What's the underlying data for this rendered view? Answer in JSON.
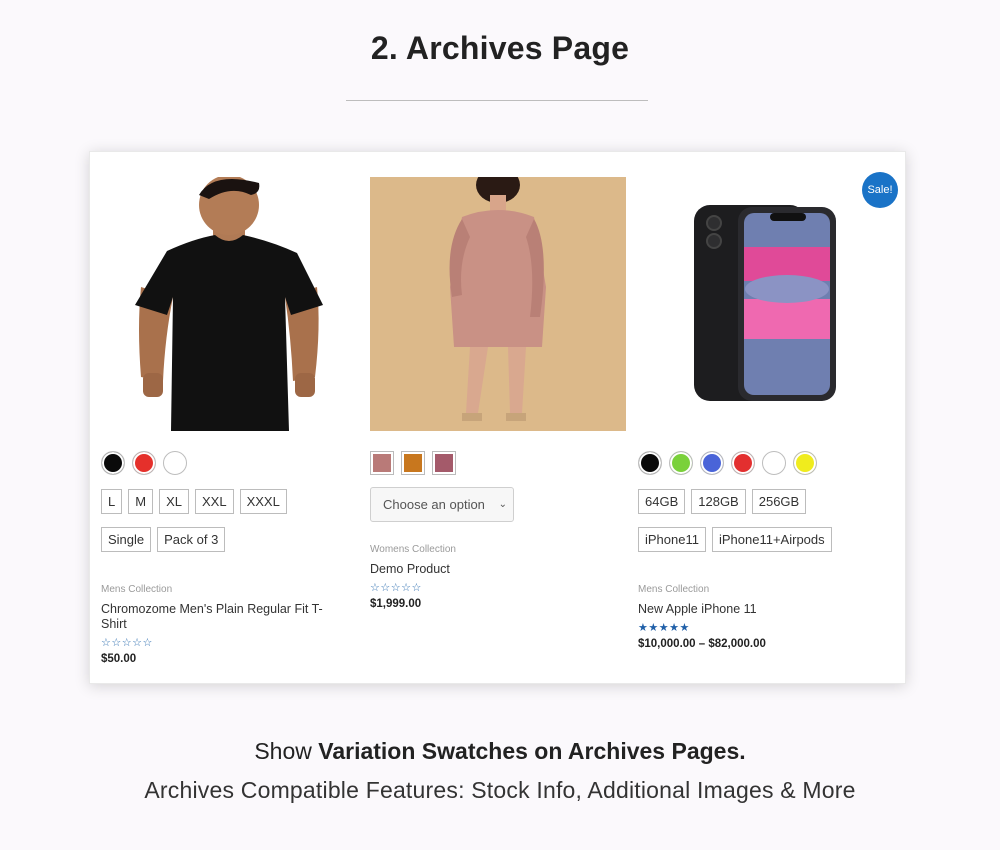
{
  "heading": "2. Archives Page",
  "sale_badge": "Sale!",
  "products": [
    {
      "image": "black-tshirt-man",
      "color_swatches": [
        "#0a0a0a",
        "#e5302b",
        "#ffffff"
      ],
      "sizes": [
        "L",
        "M",
        "XL",
        "XXL",
        "XXXL"
      ],
      "packs": [
        "Single",
        "Pack of 3"
      ],
      "category": "Mens Collection",
      "title": "Chromozome Men's Plain Regular Fit T-Shirt",
      "stars": "☆☆☆☆☆",
      "price": "$50.00"
    },
    {
      "image": "pink-sequin-dress",
      "image_swatches": [
        "#b97a78",
        "#c8771e",
        "#a45a6a"
      ],
      "select_placeholder": "Choose an option",
      "category": "Womens Collection",
      "title": "Demo Product",
      "stars": "☆☆☆☆☆",
      "price": "$1,999.00"
    },
    {
      "image": "apple-iphone-11",
      "color_swatches": [
        "#0a0a0a",
        "#7ad13a",
        "#4a64d8",
        "#e32f2f",
        "#ffffff",
        "#f0ec1d"
      ],
      "storage": [
        "64GB",
        "128GB",
        "256GB"
      ],
      "bundles": [
        "iPhone11",
        "iPhone11+Airpods"
      ],
      "category": "Mens Collection",
      "title": "New Apple iPhone 11",
      "stars": "★★★★★",
      "price": "$10,000.00 – $82,000.00"
    }
  ],
  "subtitle": {
    "prefix": "Show ",
    "bold": "Variation Swatches on Archives Pages.",
    "line2": "Archives Compatible Features: Stock Info, Additional Images & More"
  }
}
